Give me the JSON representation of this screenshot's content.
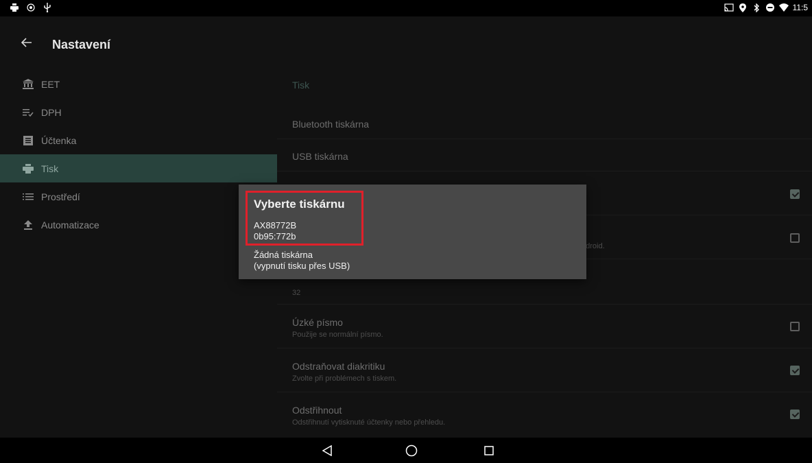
{
  "status_bar": {
    "time": "11:5",
    "left_icons": [
      "printer-icon",
      "target-icon",
      "usb-icon"
    ],
    "right_icons": [
      "cast-icon",
      "location-icon",
      "bluetooth-icon",
      "do-not-disturb-icon",
      "wifi-icon"
    ]
  },
  "app_bar": {
    "title": "Nastavení"
  },
  "sidebar": {
    "items": [
      {
        "label": "EET",
        "icon": "bank-icon",
        "active": false
      },
      {
        "label": "DPH",
        "icon": "tax-list-icon",
        "active": false
      },
      {
        "label": "Účtenka",
        "icon": "receipt-icon",
        "active": false
      },
      {
        "label": "Tisk",
        "icon": "printer-icon",
        "active": true
      },
      {
        "label": "Prostředí",
        "icon": "list-icon",
        "active": false
      },
      {
        "label": "Automatizace",
        "icon": "upload-icon",
        "active": false
      }
    ]
  },
  "settings": {
    "section_title": "Tisk",
    "rows": [
      {
        "title": "Bluetooth tiskárna",
        "subtitle": "",
        "checkbox": null
      },
      {
        "title": "USB tiskárna",
        "subtitle": "",
        "checkbox": null
      },
      {
        "title": "",
        "subtitle": "",
        "checkbox": true
      },
      {
        "title": "",
        "subtitle": "ndroid.",
        "checkbox": false
      },
      {
        "title": "",
        "subtitle": "32",
        "checkbox": null
      },
      {
        "title": "Úzké písmo",
        "subtitle": "Použije se normální písmo.",
        "checkbox": false
      },
      {
        "title": "Odstraňovat diakritiku",
        "subtitle": "Zvolte při problémech s tiskem.",
        "checkbox": true
      },
      {
        "title": "Odstřihnout",
        "subtitle": "Odstřihnutí vytisknuté účtenky nebo přehledu.",
        "checkbox": true
      }
    ]
  },
  "dialog": {
    "title": "Vyberte tiskárnu",
    "options": [
      {
        "line1": "AX88772B",
        "line2": "0b95:772b"
      },
      {
        "line1": "Žádná tiskárna",
        "line2": "(vypnutí tisku přes USB)"
      }
    ],
    "highlight_color": "#e0202a"
  },
  "nav_bar": {
    "buttons": [
      "back-triangle-icon",
      "home-circle-icon",
      "recents-square-icon"
    ]
  },
  "colors": {
    "accent": "#28433d",
    "background": "#121212",
    "dialog": "#484848"
  }
}
